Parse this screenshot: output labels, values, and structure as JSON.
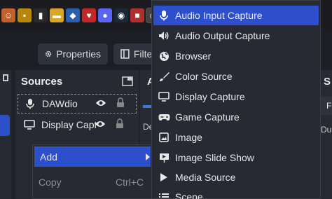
{
  "taskbar": {
    "icons": [
      "app-icon",
      "folder-icon",
      "video-icon",
      "shield-icon",
      "game-icon",
      "discord-icon",
      "steam-icon",
      "media-icon",
      "obs-icon",
      "chrome-icon"
    ]
  },
  "toolbar": {
    "properties_label": "Properties",
    "filters_label": "Filter"
  },
  "sources": {
    "title": "Sources",
    "items": [
      {
        "label": "DAWdio",
        "icon": "microphone-icon"
      },
      {
        "label": "Display Captu",
        "icon": "monitor-icon"
      }
    ]
  },
  "mid_dock": {
    "title": "A",
    "partial_text": "De"
  },
  "right_dock": {
    "title": "S",
    "partial_top": "F",
    "partial_text": "Du"
  },
  "context_menu": {
    "items": [
      {
        "label": "Add",
        "shortcut": "",
        "has_submenu": true
      },
      {
        "label": "Copy",
        "shortcut": "Ctrl+C",
        "has_submenu": false
      }
    ]
  },
  "add_submenu": {
    "items": [
      {
        "label": "Audio Input Capture",
        "icon": "microphone-icon"
      },
      {
        "label": "Audio Output Capture",
        "icon": "speaker-icon"
      },
      {
        "label": "Browser",
        "icon": "globe-icon"
      },
      {
        "label": "Color Source",
        "icon": "brush-icon"
      },
      {
        "label": "Display Capture",
        "icon": "monitor-icon"
      },
      {
        "label": "Game Capture",
        "icon": "gamepad-icon"
      },
      {
        "label": "Image",
        "icon": "image-icon"
      },
      {
        "label": "Image Slide Show",
        "icon": "slideshow-icon"
      },
      {
        "label": "Media Source",
        "icon": "play-icon"
      },
      {
        "label": "Scene",
        "icon": "list-icon"
      }
    ]
  },
  "colors": {
    "accent": "#2d4fcc",
    "panel": "#272a33",
    "background": "#1f222a"
  }
}
